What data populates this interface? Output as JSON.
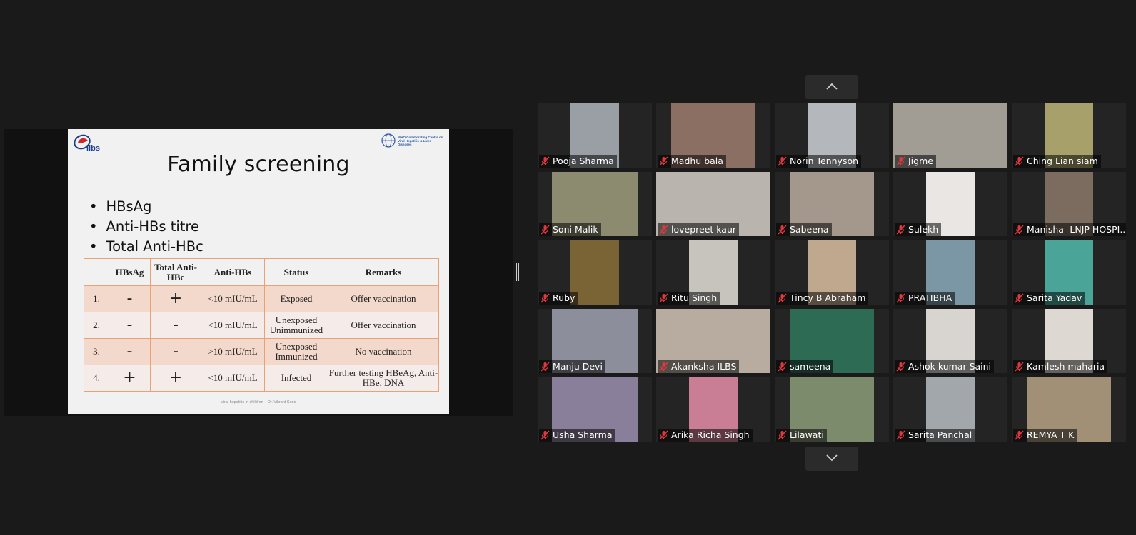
{
  "slide": {
    "title": "Family screening",
    "logo_text": "ilbs",
    "who_text": "WHO Collaborating Centre on Viral Hepatitis & Liver Diseases",
    "bullets": [
      "HBsAg",
      "Anti-HBs titre",
      "Total Anti-HBc"
    ],
    "table": {
      "headers": [
        "",
        "HBsAg",
        "Total Anti-HBc",
        "Anti-HBs",
        "Status",
        "Remarks"
      ],
      "rows": [
        [
          "1.",
          "-",
          "+",
          "<10 mIU/mL",
          "Exposed",
          "Offer vaccination"
        ],
        [
          "2.",
          "-",
          "-",
          "<10 mIU/mL",
          "Unexposed Unimmunized",
          "Offer vaccination"
        ],
        [
          "3.",
          "-",
          "-",
          ">10 mIU/mL",
          "Unexposed Immunized",
          "No vaccination"
        ],
        [
          "4.",
          "+",
          "+",
          "<10 mIU/mL",
          "Infected",
          "Further testing HBeAg, Anti-HBe, DNA"
        ]
      ]
    },
    "footer": "Viral hepatitis in children – Dr. Vikrant Sood"
  },
  "participants": [
    {
      "name": "Pooja Sharma",
      "color": "#9a9fa6"
    },
    {
      "name": "Madhu bala",
      "color": "#8c6f63"
    },
    {
      "name": "Norin Tennyson",
      "color": "#b4b8bc"
    },
    {
      "name": "Jigme",
      "color": "#a19c94"
    },
    {
      "name": "Ching Lian siam",
      "color": "#a7a06a"
    },
    {
      "name": "Soni Malik",
      "color": "#8c8b70"
    },
    {
      "name": "lovepreet kaur",
      "color": "#b9b4ae"
    },
    {
      "name": "Sabeena",
      "color": "#a4988d"
    },
    {
      "name": "Sulekh",
      "color": "#e9e6e4"
    },
    {
      "name": "Manisha- LNJP HOSPI...",
      "color": "#7c6c60"
    },
    {
      "name": "Ruby",
      "color": "#7a6436"
    },
    {
      "name": "Ritu Singh",
      "color": "#c7c3bd"
    },
    {
      "name": "Tincy B Abraham",
      "color": "#c0a88e"
    },
    {
      "name": "PRATIBHA",
      "color": "#7b97a5"
    },
    {
      "name": "Sarita Yadav",
      "color": "#4aa497"
    },
    {
      "name": "Manju Devi",
      "color": "#8c8f9b"
    },
    {
      "name": "Akanksha ILBS",
      "color": "#b8aca0"
    },
    {
      "name": "sameena",
      "color": "#2d6b54"
    },
    {
      "name": "Ashok kumar Saini",
      "color": "#d8d4d0"
    },
    {
      "name": "Kamlesh maharia",
      "color": "#ddd8d2"
    },
    {
      "name": "Usha Sharma",
      "color": "#8a7f9a"
    },
    {
      "name": "Arika Richa Singh",
      "color": "#c97e95"
    },
    {
      "name": "Lilawati",
      "color": "#7c8b6b"
    },
    {
      "name": "Sarita Panchal",
      "color": "#a2a7ab"
    },
    {
      "name": "REMYA T K",
      "color": "#a19076"
    }
  ]
}
